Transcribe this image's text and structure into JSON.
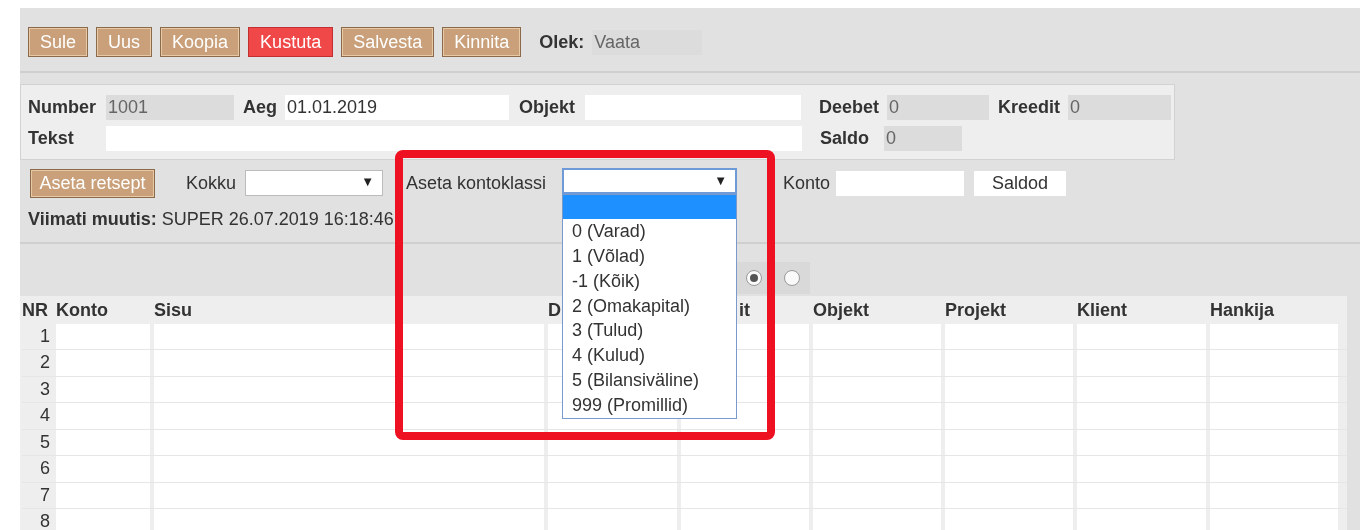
{
  "toolbar": {
    "buttons": [
      {
        "label": "Sule",
        "kind": "normal"
      },
      {
        "label": "Uus",
        "kind": "normal"
      },
      {
        "label": "Koopia",
        "kind": "normal"
      },
      {
        "label": "Kustuta",
        "kind": "danger"
      },
      {
        "label": "Salvesta",
        "kind": "normal"
      },
      {
        "label": "Kinnita",
        "kind": "normal"
      }
    ],
    "status": {
      "label": "Olek:",
      "value": "Vaata",
      "readonly": true
    }
  },
  "header_form": {
    "number": {
      "label": "Number",
      "value": "1001",
      "readonly": true
    },
    "aeg": {
      "label": "Aeg",
      "value": "01.01.2019",
      "readonly": false
    },
    "objekt": {
      "label": "Objekt",
      "readonly": false
    },
    "deebet": {
      "label": "Deebet",
      "value": "0",
      "readonly": true
    },
    "kreedit": {
      "label": "Kreedit",
      "value": "0",
      "readonly": true
    },
    "tekst": {
      "label": "Tekst",
      "readonly": false
    },
    "saldo": {
      "label": "Saldo",
      "value": "0",
      "readonly": true
    }
  },
  "actions": {
    "recipe_button": "Aseta retsept",
    "kokku": {
      "label": "Kokku",
      "open": false,
      "caret": "▼"
    },
    "kontoklassi": {
      "label": "Aseta kontoklassi",
      "open": true,
      "caret": "▼",
      "options": [
        {
          "selected": true
        },
        {
          "label": "0 (Varad)",
          "selected": false
        },
        {
          "label": "1 (Võlad)",
          "selected": false
        },
        {
          "label": "-1 (Kõik)",
          "selected": false
        },
        {
          "label": "2 (Omakapital)",
          "selected": false
        },
        {
          "label": "3 (Tulud)",
          "selected": false
        },
        {
          "label": "4 (Kulud)",
          "selected": false
        },
        {
          "label": "5 (Bilansiväline)",
          "selected": false
        },
        {
          "label": "999 (Promillid)",
          "selected": false
        }
      ]
    },
    "konto": {
      "label": "Konto"
    },
    "saldod_button": "Saldod"
  },
  "last_modified": {
    "label": "Viimati muutis:",
    "value": "SUPER 26.07.2019 16:18:46"
  },
  "radios": [
    {
      "selected": true
    },
    {
      "selected": false
    }
  ],
  "table": {
    "columns": [
      "NR",
      "Konto",
      "Sisu",
      "D",
      "it",
      "Objekt",
      "Projekt",
      "Klient",
      "Hankija"
    ],
    "rows": [
      {
        "nr": "1"
      },
      {
        "nr": "2"
      },
      {
        "nr": "3"
      },
      {
        "nr": "4"
      },
      {
        "nr": "5"
      },
      {
        "nr": "6"
      },
      {
        "nr": "7"
      },
      {
        "nr": "8"
      }
    ]
  }
}
